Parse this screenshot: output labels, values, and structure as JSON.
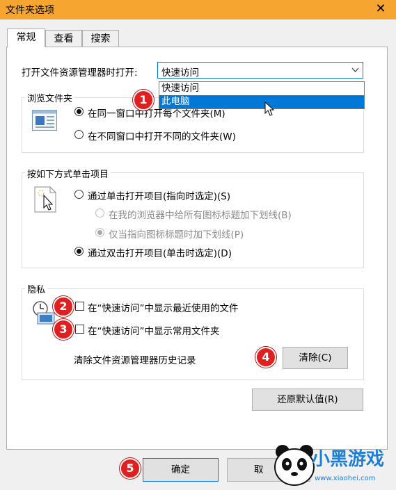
{
  "window": {
    "title": "文件夹选项",
    "close_glyph": "✕",
    "titlebar_color": "#f6a530"
  },
  "tabs": [
    {
      "label": "常规",
      "active": true
    },
    {
      "label": "查看",
      "active": false
    },
    {
      "label": "搜索",
      "active": false
    }
  ],
  "open_in": {
    "label": "打开文件资源管理器时打开:",
    "value": "快速访问",
    "options": [
      {
        "label": "快速访问",
        "highlighted": false
      },
      {
        "label": "此电脑",
        "highlighted": true
      }
    ]
  },
  "browse_group": {
    "legend": "浏览文件夹",
    "icon": "folder-window-icon",
    "options": [
      {
        "label": "在同一窗口中打开每个文件夹(M)",
        "checked": true
      },
      {
        "label": "在不同窗口中打开不同的文件夹(W)",
        "checked": false
      }
    ]
  },
  "click_group": {
    "legend": "按如下方式单击项目",
    "icon": "cursor-click-icon",
    "options": [
      {
        "label": "通过单击打开项目(指向时选定)(S)",
        "checked": false,
        "disabled": false
      },
      {
        "label": "在我的浏览器中给所有图标标题加下划线(B)",
        "checked": false,
        "disabled": true
      },
      {
        "label": "仅当指向图标标题时加下划线(P)",
        "checked": true,
        "disabled": true
      },
      {
        "label": "通过双击打开项目(单击时选定)(D)",
        "checked": true,
        "disabled": false
      }
    ]
  },
  "privacy_group": {
    "legend": "隐私",
    "icon": "clock-picture-icon",
    "checks": [
      {
        "label": "在“快速访问”中显示最近使用的文件",
        "checked": false
      },
      {
        "label": "在“快速访问”中显示常用文件夹",
        "checked": false
      }
    ],
    "clear_label": "清除文件资源管理器历史记录",
    "clear_button": "清除(C)"
  },
  "restore_button": "还原默认值(R)",
  "ok_button": "确定",
  "cancel_button_partial": "取",
  "badges": [
    "1",
    "2",
    "3",
    "4",
    "5"
  ],
  "watermark": {
    "text": "小黑游戏",
    "url": "www.xiaohei.com"
  },
  "colors": {
    "accent": "#0078d7",
    "badge": "#e02020"
  }
}
